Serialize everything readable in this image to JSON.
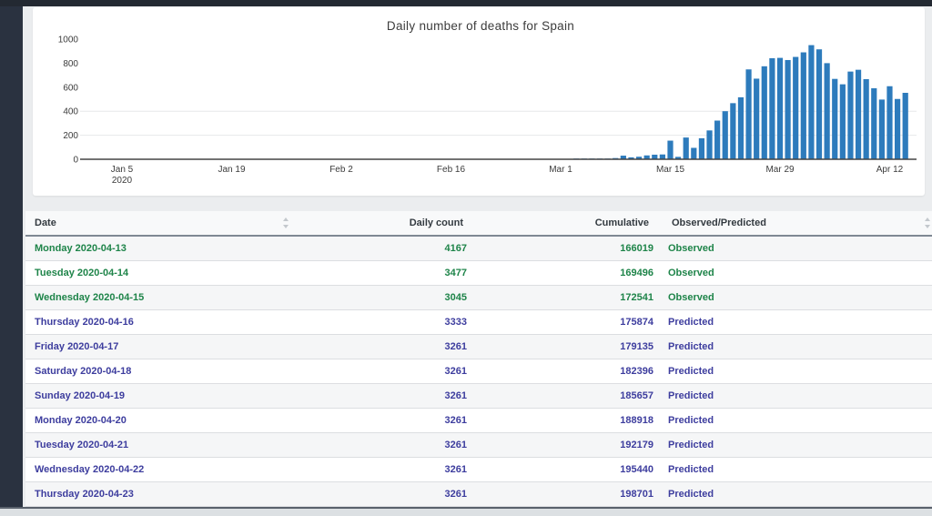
{
  "chart_data": {
    "type": "bar",
    "title": "Daily number of deaths for Spain",
    "xlabel": "",
    "ylabel": "",
    "ylim": [
      0,
      1000
    ],
    "y_ticks": [
      0,
      200,
      400,
      600,
      800,
      1000
    ],
    "gridline_values": [
      200,
      400
    ],
    "grid": "partial-horizontal",
    "legend": "none",
    "bar_color": "#2d7bbc",
    "axis_color": "#444444",
    "tick_text_color": "#3b3b3b",
    "x_ticks": [
      {
        "label": "Jan 5",
        "sublabel": "2020",
        "day": 0
      },
      {
        "label": "Jan 19",
        "day": 14
      },
      {
        "label": "Feb 2",
        "day": 28
      },
      {
        "label": "Feb 16",
        "day": 42
      },
      {
        "label": "Mar 1",
        "day": 56
      },
      {
        "label": "Mar 15",
        "day": 70
      },
      {
        "label": "Mar 29",
        "day": 84
      },
      {
        "label": "Apr 12",
        "day": 98
      }
    ],
    "first_day_offset": 58,
    "x": [
      "2020-03-03",
      "2020-03-04",
      "2020-03-05",
      "2020-03-06",
      "2020-03-07",
      "2020-03-08",
      "2020-03-09",
      "2020-03-10",
      "2020-03-11",
      "2020-03-12",
      "2020-03-13",
      "2020-03-14",
      "2020-03-15",
      "2020-03-16",
      "2020-03-17",
      "2020-03-18",
      "2020-03-19",
      "2020-03-20",
      "2020-03-21",
      "2020-03-22",
      "2020-03-23",
      "2020-03-24",
      "2020-03-25",
      "2020-03-26",
      "2020-03-27",
      "2020-03-28",
      "2020-03-29",
      "2020-03-30",
      "2020-03-31",
      "2020-04-01",
      "2020-04-02",
      "2020-04-03",
      "2020-04-04",
      "2020-04-05",
      "2020-04-06",
      "2020-04-07",
      "2020-04-08",
      "2020-04-09",
      "2020-04-10",
      "2020-04-11",
      "2020-04-12",
      "2020-04-13",
      "2020-04-14"
    ],
    "values": [
      2,
      3,
      3,
      5,
      6,
      10,
      30,
      16,
      21,
      32,
      38,
      40,
      155,
      20,
      181,
      95,
      175,
      240,
      322,
      400,
      467,
      516,
      748,
      671,
      774,
      841,
      844,
      826,
      852,
      890,
      950,
      915,
      800,
      669,
      624,
      730,
      745,
      667,
      591,
      497,
      608,
      502,
      553
    ]
  },
  "table": {
    "columns": [
      {
        "label": "Date",
        "align": "left",
        "sortable": true
      },
      {
        "label": "Daily count",
        "align": "right",
        "sortable": true
      },
      {
        "label": "Cumulative",
        "align": "right",
        "sortable": true
      },
      {
        "label": "Observed/Predicted",
        "align": "left",
        "sortable": true
      }
    ],
    "status_colors": {
      "Observed": "#1e8449",
      "Predicted": "#3d3d9e"
    },
    "rows": [
      {
        "date": "Monday 2020-04-13",
        "daily": "4167",
        "cumulative": "166019",
        "status": "Observed"
      },
      {
        "date": "Tuesday 2020-04-14",
        "daily": "3477",
        "cumulative": "169496",
        "status": "Observed"
      },
      {
        "date": "Wednesday 2020-04-15",
        "daily": "3045",
        "cumulative": "172541",
        "status": "Observed"
      },
      {
        "date": "Thursday 2020-04-16",
        "daily": "3333",
        "cumulative": "175874",
        "status": "Predicted"
      },
      {
        "date": "Friday 2020-04-17",
        "daily": "3261",
        "cumulative": "179135",
        "status": "Predicted"
      },
      {
        "date": "Saturday 2020-04-18",
        "daily": "3261",
        "cumulative": "182396",
        "status": "Predicted"
      },
      {
        "date": "Sunday 2020-04-19",
        "daily": "3261",
        "cumulative": "185657",
        "status": "Predicted"
      },
      {
        "date": "Monday 2020-04-20",
        "daily": "3261",
        "cumulative": "188918",
        "status": "Predicted"
      },
      {
        "date": "Tuesday 2020-04-21",
        "daily": "3261",
        "cumulative": "192179",
        "status": "Predicted"
      },
      {
        "date": "Wednesday 2020-04-22",
        "daily": "3261",
        "cumulative": "195440",
        "status": "Predicted"
      },
      {
        "date": "Thursday 2020-04-23",
        "daily": "3261",
        "cumulative": "198701",
        "status": "Predicted"
      }
    ]
  }
}
